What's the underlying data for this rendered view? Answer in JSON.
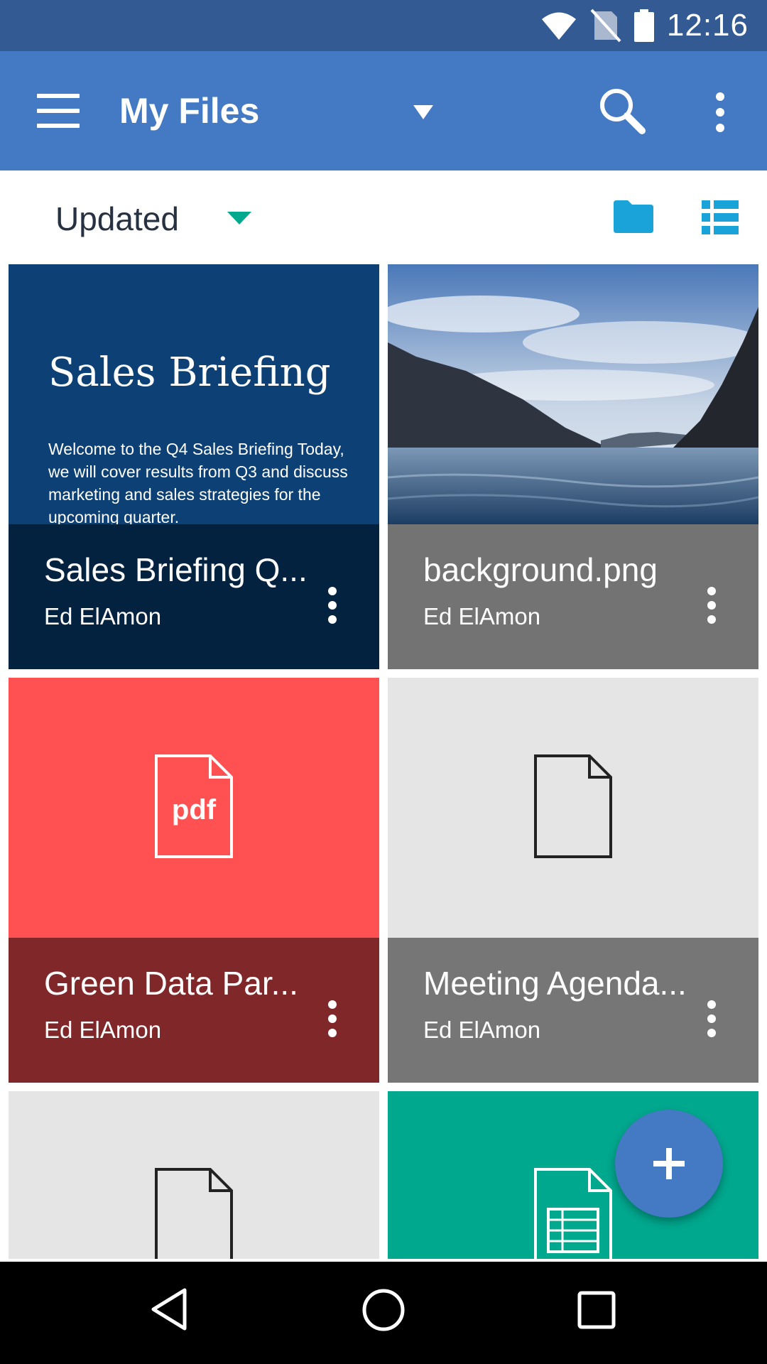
{
  "status_bar": {
    "time": "12:16",
    "icons": [
      "wifi-icon",
      "no-sim-icon",
      "battery-icon"
    ]
  },
  "app_bar": {
    "title": "My Files",
    "icons": [
      "menu-icon",
      "dropdown-icon",
      "search-icon",
      "overflow-menu-icon"
    ]
  },
  "sort_bar": {
    "label": "Updated",
    "icons": [
      "folder-icon",
      "list-view-icon"
    ],
    "accent": "#1aa3d8"
  },
  "files": [
    {
      "name": "Sales Briefing Q...",
      "owner": "Ed ElAmon",
      "thumbnail": {
        "title": "Sales Briefing",
        "body": "Welcome to the Q4 Sales Briefing Today, we will cover results from Q3 and discuss marketing and sales strategies for the upcoming quarter."
      }
    },
    {
      "name": "background.png",
      "owner": "Ed ElAmon"
    },
    {
      "name": "Green Data Par...",
      "owner": "Ed ElAmon",
      "thumbnail": {
        "label": "pdf"
      }
    },
    {
      "name": "Meeting Agenda...",
      "owner": "Ed ElAmon"
    }
  ],
  "fab": {
    "icon": "plus-icon",
    "color": "#4479c3"
  },
  "nav_bar": {
    "icons": [
      "back-icon",
      "home-icon",
      "recents-icon"
    ]
  }
}
